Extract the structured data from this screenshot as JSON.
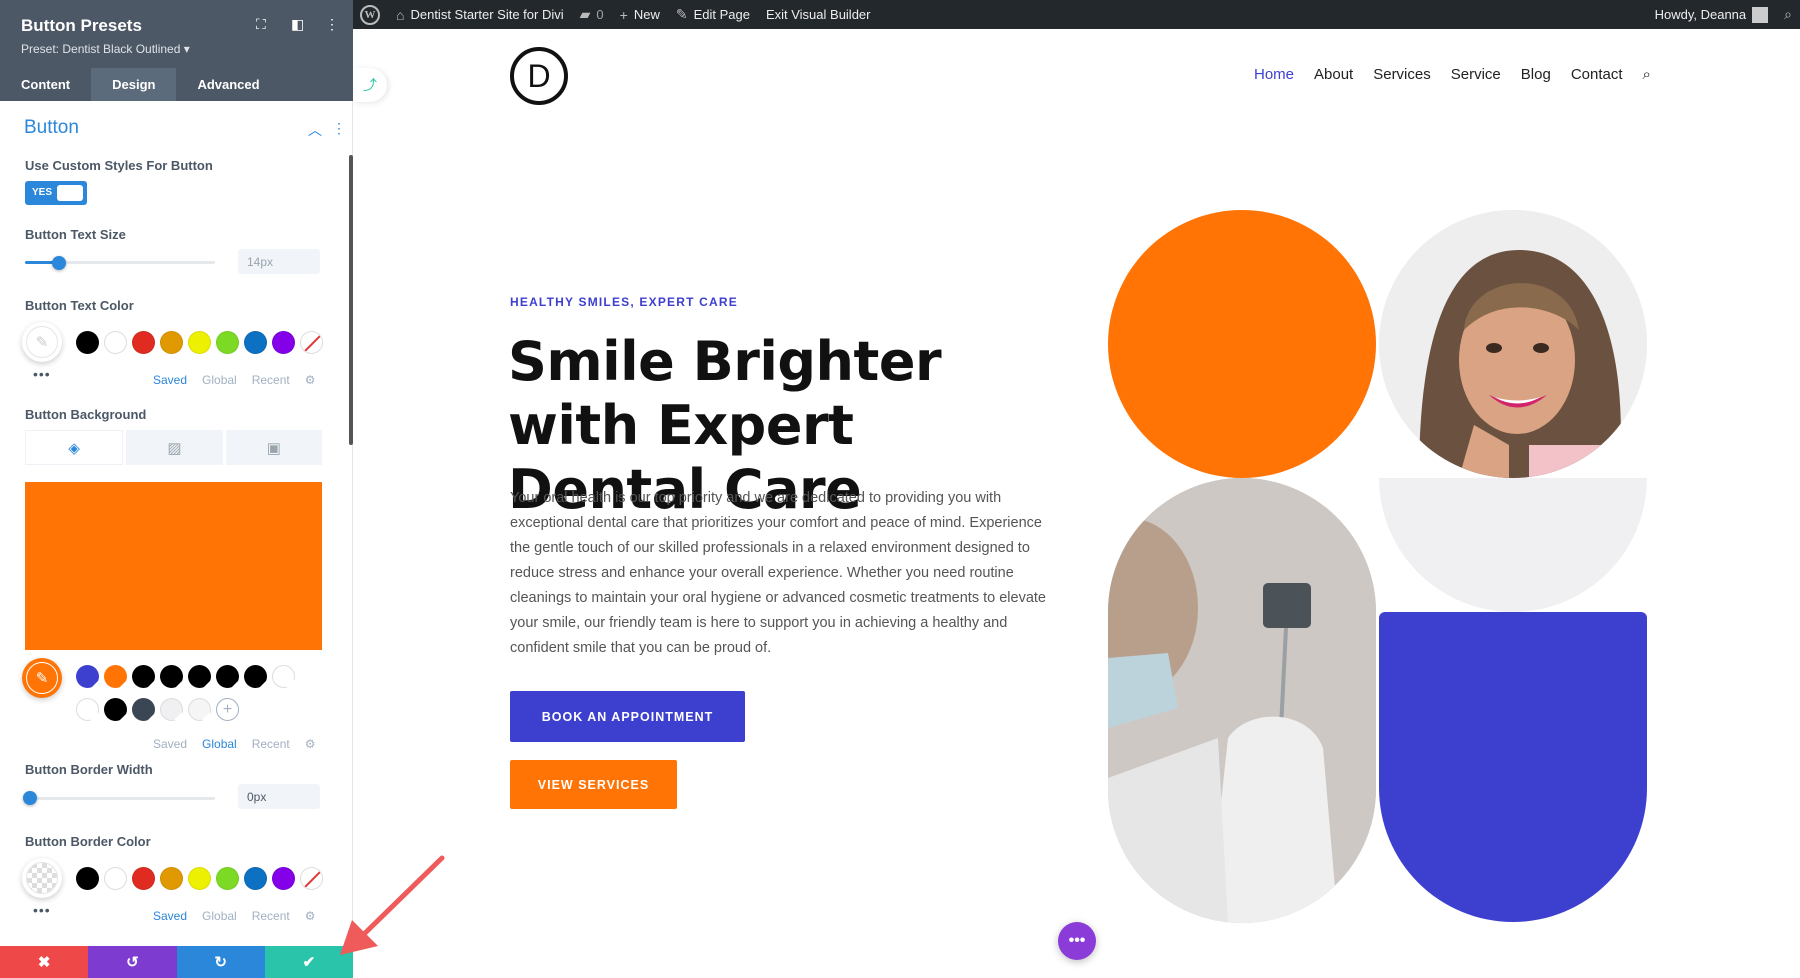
{
  "adminbar": {
    "site_name": "Dentist Starter Site for Divi",
    "comments_count": "0",
    "new_label": "New",
    "edit_page_label": "Edit Page",
    "exit_label": "Exit Visual Builder",
    "howdy": "Howdy, Deanna"
  },
  "panel": {
    "title": "Button Presets",
    "preset": "Preset: Dentist Black Outlined ▾",
    "tabs": [
      "Content",
      "Design",
      "Advanced"
    ],
    "active_tab": "Design",
    "section_title": "Button",
    "custom_styles_label": "Use Custom Styles For Button",
    "toggle_value": "YES",
    "text_size_label": "Button Text Size",
    "text_size_value": "14px",
    "text_size_fraction": 0.15,
    "text_color_label": "Button Text Color",
    "background_label": "Button Background",
    "background_color": "#ff7405",
    "border_width_label": "Button Border Width",
    "border_width_value": "0px",
    "border_width_fraction": 0.0,
    "border_color_label": "Button Border Color",
    "palette_links": [
      "Saved",
      "Global",
      "Recent"
    ],
    "default_palette": [
      "#000000",
      "#ffffff",
      "#e02b20",
      "#e09900",
      "#edf000",
      "#7cda24",
      "#0c71c3",
      "#8300e9"
    ],
    "global_palette_row1": [
      "#3d3fcf",
      "#ff7405",
      "#000000",
      "#000000",
      "#000000",
      "#000000",
      "#000000",
      "#ffffff"
    ],
    "global_palette_row2": [
      "#ffffff",
      "#000000",
      "#3a4654",
      "#f0f0f2",
      "#f5f5f5"
    ],
    "bottom_bar_colors": [
      "#ef4848",
      "#7e3bd0",
      "#2b87da",
      "#29c4a9"
    ]
  },
  "site": {
    "logo_letter": "D",
    "nav": [
      "Home",
      "About",
      "Services",
      "Service",
      "Blog",
      "Contact"
    ],
    "active_nav": "Home",
    "eyebrow": "HEALTHY SMILES, EXPERT CARE",
    "headline": "Smile Brighter with Expert Dental Care",
    "body": "Your oral health is our top priority and we are dedicated to providing you with exceptional dental care that prioritizes your comfort and peace of mind. Experience the gentle touch of our skilled professionals in a relaxed environment designed to reduce stress and enhance your overall experience. Whether you need routine cleanings to maintain your oral hygiene or advanced cosmetic treatments to elevate your smile, our friendly team is here to support you in achieving a healthy and confident smile that you can be proud of.",
    "cta_primary": "BOOK AN APPOINTMENT",
    "cta_secondary": "VIEW SERVICES",
    "accent_blue": "#3d3fcf",
    "accent_orange": "#ff7405"
  }
}
